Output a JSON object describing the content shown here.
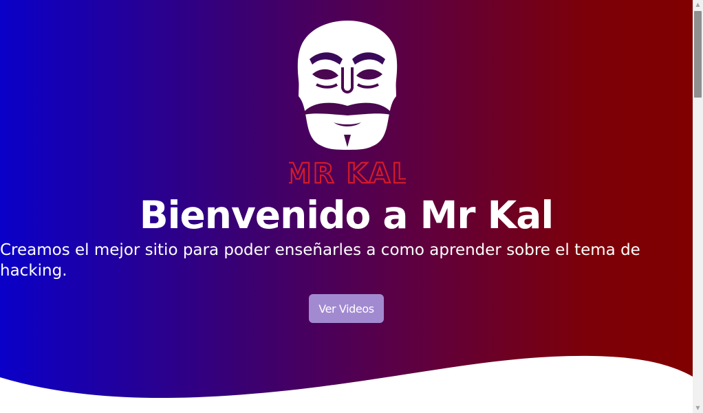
{
  "hero": {
    "logo_text": "MR KAL",
    "title": "Bienvenido a Mr Kal",
    "subtitle": "Creamos el mejor sitio para poder enseñarles a como aprender sobre el tema de hacking.",
    "cta_label": "Ver Videos"
  },
  "colors": {
    "gradient_left": "#0a00c8",
    "gradient_right": "#800000",
    "button": "#a28ad0",
    "logo_text": "#d41a28",
    "mask": "#ffffff"
  },
  "icons": {
    "logo": "fsociety-mask-icon"
  }
}
